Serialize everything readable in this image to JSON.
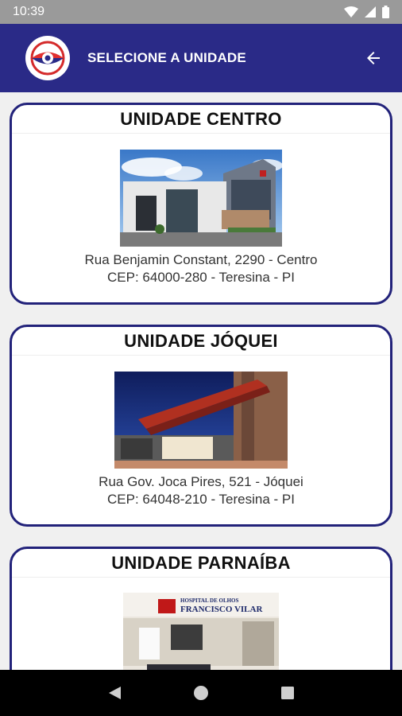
{
  "status_bar": {
    "time": "10:39",
    "icons": [
      "wifi-icon",
      "signal-icon",
      "battery-icon"
    ]
  },
  "app_bar": {
    "title": "SELECIONE A UNIDADE",
    "back_icon": "arrow-back-icon"
  },
  "colors": {
    "primary": "#2a2a87",
    "card_border": "#22227a",
    "status_bar": "#9a9a9a"
  },
  "units": [
    {
      "title": "UNIDADE CENTRO",
      "address_line1": "Rua Benjamin Constant, 2290 - Centro",
      "address_line2": "CEP: 64000-280 - Teresina - PI"
    },
    {
      "title": "UNIDADE JÓQUEI",
      "address_line1": "Rua Gov. Joca Pires, 521 - Jóquei",
      "address_line2": "CEP: 64048-210 - Teresina - PI"
    },
    {
      "title": "UNIDADE PARNAÍBA",
      "sign_line1": "HOSPITAL DE OLHOS",
      "sign_line2": "FRANCISCO VILAR"
    }
  ],
  "nav_bar": {
    "back": "nav-back-icon",
    "home": "nav-home-icon",
    "recents": "nav-recents-icon"
  }
}
